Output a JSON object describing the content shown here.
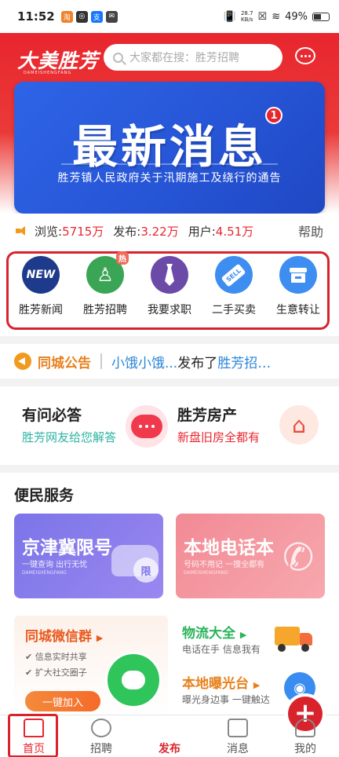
{
  "status_bar": {
    "time": "11:52",
    "net_speed_value": "28.7",
    "net_speed_unit": "KB/s",
    "battery": "49%"
  },
  "header": {
    "logo_text": "大美胜芳",
    "logo_sub": "DAMEISHENGFANG",
    "search_placeholder": "大家都在搜：胜芳招聘"
  },
  "banner": {
    "title": "最新消息",
    "badge": "1",
    "subtitle": "胜芳镇人民政府关于汛期施工及绕行的通告"
  },
  "stats": {
    "views_label": "浏览:",
    "views_value": "5715万",
    "posts_label": "发布:",
    "posts_value": "3.22万",
    "users_label": "用户:",
    "users_value": "4.51万",
    "help": "帮助"
  },
  "categories": [
    {
      "label": "胜芳新闻",
      "icon": "new-icon",
      "icon_text": "NEW",
      "color": "#1e3a8a"
    },
    {
      "label": "胜芳招聘",
      "icon": "person-add-icon",
      "color": "#3aa655",
      "hot": "热"
    },
    {
      "label": "我要求职",
      "icon": "tie-icon",
      "color": "#6b4aa8"
    },
    {
      "label": "二手买卖",
      "icon": "sell-tag-icon",
      "icon_text": "SELL",
      "color": "#3d8ef0"
    },
    {
      "label": "生意转让",
      "icon": "shop-icon",
      "color": "#3d8ef0"
    }
  ],
  "notice": {
    "title": "同城公告",
    "user": "小饿小饿...",
    "action": "发布了",
    "target": "胜芳招…"
  },
  "qa": {
    "left_title": "有问必答",
    "left_sub": "胜芳网友给您解答",
    "right_title": "胜芳房产",
    "right_sub": "新盘旧房全都有"
  },
  "services": {
    "title": "便民服务",
    "card1": {
      "title": "京津冀限号",
      "sub": "一键查询 出行无忧",
      "tiny": "DAMEISHENGFANG",
      "tag": "限"
    },
    "card2": {
      "title": "本地电话本",
      "sub": "号码不用记 一搜全都有",
      "tiny": "DAMEISHENGFANG"
    },
    "wechat_group": {
      "title": "同城微信群",
      "item1": "信息实时共享",
      "item2": "扩大社交圈子",
      "button": "一键加入"
    },
    "logistics": {
      "title": "物流大全",
      "sub": "电话在手 信息我有"
    },
    "exposure": {
      "title": "本地曝光台",
      "sub": "曝光身边事 一键触达"
    }
  },
  "bottom_nav": {
    "home": "首页",
    "jobs": "招聘",
    "publish": "发布",
    "messages": "消息",
    "mine": "我的"
  },
  "colors": {
    "brand_red": "#e8262e",
    "highlight_outline": "#d9232c",
    "value_red": "#e8262e",
    "notice_orange": "#e8801d",
    "link_blue": "#2a86d9"
  }
}
